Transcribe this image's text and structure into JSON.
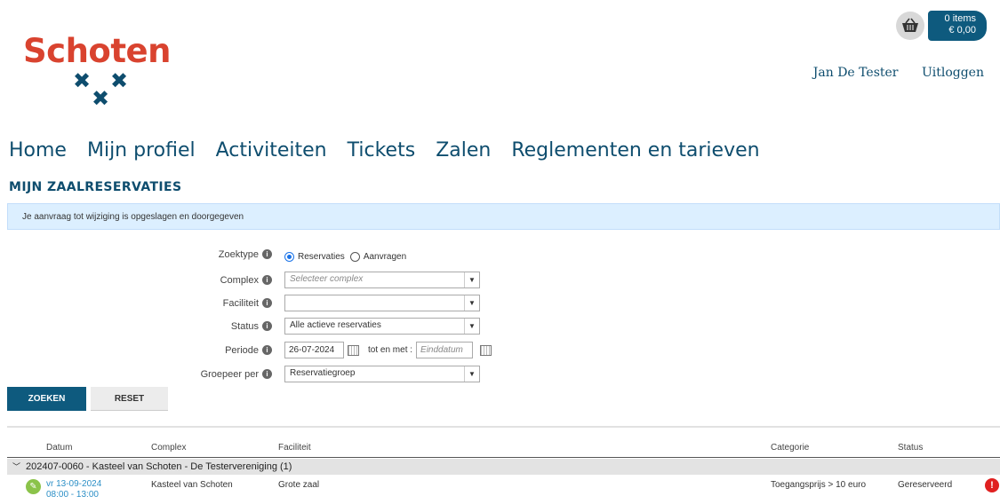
{
  "header": {
    "logo_text": "Schoten",
    "cart": {
      "items": "0 items",
      "total": "€ 0,00",
      "icon": "basket-icon"
    },
    "user_name": "Jan De Tester",
    "logout_label": "Uitloggen"
  },
  "nav": {
    "items": [
      "Home",
      "Mijn profiel",
      "Activiteiten",
      "Tickets",
      "Zalen",
      "Reglementen en tarieven"
    ]
  },
  "page_title": "MIJN ZAALRESERVATIES",
  "alert_message": "Je aanvraag tot wijziging is opgeslagen en doorgegeven",
  "form": {
    "zoektype": {
      "label": "Zoektype",
      "options": [
        "Reservaties",
        "Aanvragen"
      ],
      "selected": "Reservaties"
    },
    "complex": {
      "label": "Complex",
      "placeholder": "Selecteer complex"
    },
    "faciliteit": {
      "label": "Faciliteit",
      "value": ""
    },
    "status": {
      "label": "Status",
      "value": "Alle actieve reservaties"
    },
    "periode": {
      "label": "Periode",
      "start": "26-07-2024",
      "tot_label": "tot en met :",
      "end_placeholder": "Einddatum"
    },
    "groepeer": {
      "label": "Groepeer per",
      "value": "Reservatiegroep"
    },
    "search_label": "ZOEKEN",
    "reset_label": "RESET"
  },
  "table": {
    "columns": [
      "Datum",
      "Complex",
      "Faciliteit",
      "Categorie",
      "Status"
    ],
    "group": "202407-0060 - Kasteel van Schoten - De Testervereniging (1)",
    "rows": [
      {
        "date": "vr 13-09-2024",
        "time": "08:00 - 13:00",
        "complex": "Kasteel van Schoten",
        "faciliteit": "Grote zaal",
        "categorie": "Toegangsprijs > 10 euro",
        "status": "Gereserveerd"
      }
    ]
  },
  "colors": {
    "brand_red": "#d9432f",
    "brand_blue": "#0e5a7e",
    "alert_bg": "#dcefff"
  }
}
